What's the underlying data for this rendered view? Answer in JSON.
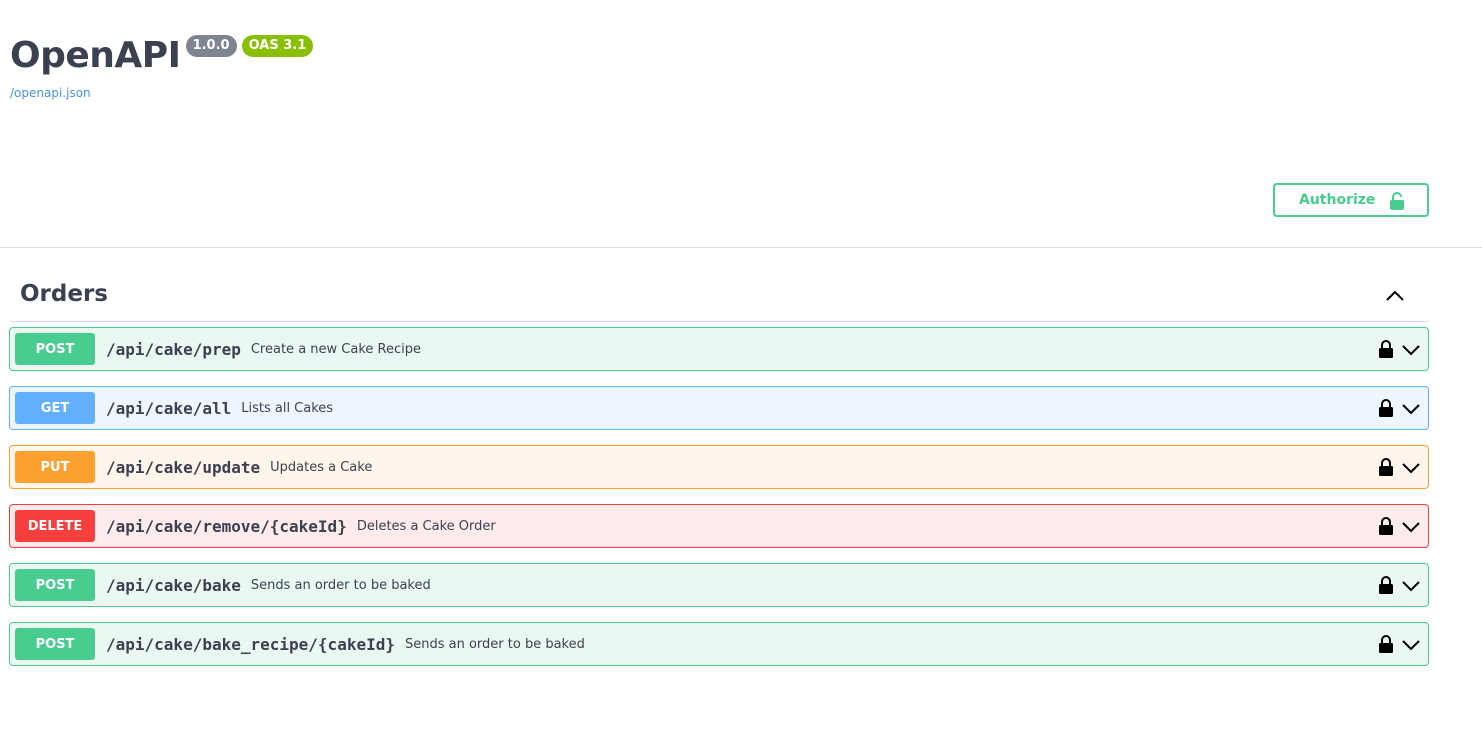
{
  "info": {
    "title": "OpenAPI",
    "version": "1.0.0",
    "oas": "OAS 3.1",
    "spec_link": "/openapi.json"
  },
  "authorize": {
    "label": "Authorize",
    "icon": "lock-icon"
  },
  "colors": {
    "post": "#49cc90",
    "get": "#61affe",
    "put": "#fca130",
    "delete": "#f93e3e",
    "text": "#3b4151",
    "link": "#4990e2"
  },
  "tag": {
    "name": "Orders",
    "toggle_icon": "chevron-up-icon"
  },
  "operations": [
    {
      "method": "POST",
      "path": "/api/cake/prep",
      "summary": "Create a new Cake Recipe"
    },
    {
      "method": "GET",
      "path": "/api/cake/all",
      "summary": "Lists all Cakes"
    },
    {
      "method": "PUT",
      "path": "/api/cake/update",
      "summary": "Updates a Cake"
    },
    {
      "method": "DELETE",
      "path": "/api/cake/remove/{cakeId}",
      "summary": "Deletes a Cake Order"
    },
    {
      "method": "POST",
      "path": "/api/cake/bake",
      "summary": "Sends an order to be baked"
    },
    {
      "method": "POST",
      "path": "/api/cake/bake_recipe/{cakeId}",
      "summary": "Sends an order to be baked"
    }
  ]
}
